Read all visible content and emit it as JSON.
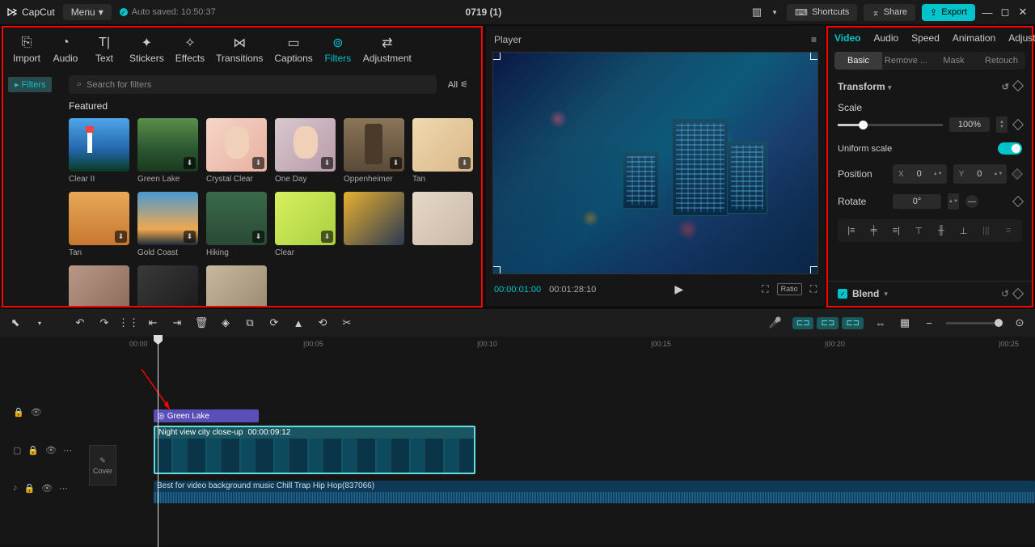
{
  "titlebar": {
    "app_name": "CapCut",
    "menu_label": "Menu",
    "autosave": "Auto saved: 10:50:37",
    "project_title": "0719 (1)",
    "shortcuts": "Shortcuts",
    "share": "Share",
    "export": "Export"
  },
  "tool_tabs": [
    {
      "label": "Import",
      "icon": "⎘"
    },
    {
      "label": "Audio",
      "icon": "◔"
    },
    {
      "label": "Text",
      "icon": "T|"
    },
    {
      "label": "Stickers",
      "icon": "✦"
    },
    {
      "label": "Effects",
      "icon": "✧"
    },
    {
      "label": "Transitions",
      "icon": "⋈"
    },
    {
      "label": "Captions",
      "icon": "▭"
    },
    {
      "label": "Filters",
      "icon": "⊚",
      "active": true
    },
    {
      "label": "Adjustment",
      "icon": "⇄"
    }
  ],
  "filters_sidebar": {
    "tag": "Filters"
  },
  "search": {
    "placeholder": "Search for filters",
    "all_label": "All"
  },
  "featured_label": "Featured",
  "filters": [
    {
      "name": "Clear II",
      "bg": "linear-gradient(180deg,#4fa4e8 0%,#2266aa 60%,#0a3a22 100%)",
      "dl": false,
      "extra": "lighthouse"
    },
    {
      "name": "Green Lake",
      "bg": "linear-gradient(180deg,#5a8f4a 0%,#2a5530 60%,#1a3a20 100%)",
      "dl": true,
      "extra": "cabin"
    },
    {
      "name": "Crystal Clear",
      "bg": "linear-gradient(135deg,#f5d5c8 0%,#e8b0a0 100%)",
      "dl": true,
      "extra": "face"
    },
    {
      "name": "One Day",
      "bg": "linear-gradient(135deg,#d8c8d0 0%,#b89aa8 100%)",
      "dl": true,
      "extra": "face"
    },
    {
      "name": "Oppenheimer",
      "bg": "linear-gradient(180deg,#8a7558 0%,#5a4a38 100%)",
      "dl": true,
      "extra": "man"
    },
    {
      "name": "",
      "bg": "",
      "dl": false
    },
    {
      "name": "Tan",
      "bg": "linear-gradient(135deg,#f0d8b0 0%,#d8b888 100%)",
      "dl": true,
      "extra": "girl"
    },
    {
      "name": "Tan",
      "bg": "linear-gradient(180deg,#e8a858 0%,#c87830 100%)",
      "dl": true,
      "extra": "guy"
    },
    {
      "name": "Gold Coast",
      "bg": "linear-gradient(180deg,#4a9ad0 0%,#f0a850 70%,#1a2a3a 100%)",
      "dl": true,
      "extra": ""
    },
    {
      "name": "Hiking",
      "bg": "linear-gradient(180deg,#3a6a4a 0%,#2a4a35 100%)",
      "dl": true,
      "extra": ""
    },
    {
      "name": "Clear",
      "bg": "linear-gradient(135deg,#d8f060 0%,#a8d040 100%)",
      "dl": true,
      "extra": ""
    },
    {
      "name": "",
      "bg": "",
      "dl": false
    },
    {
      "name": "",
      "bg": "linear-gradient(135deg,#e8b030 0%,#2a3a50 100%)",
      "dl": false
    },
    {
      "name": "",
      "bg": "linear-gradient(135deg,#e8d8c8 0%,#c8b8a8 100%)",
      "dl": false
    },
    {
      "name": "",
      "bg": "linear-gradient(135deg,#b89888 0%,#8a6858 100%)",
      "dl": false
    },
    {
      "name": "",
      "bg": "linear-gradient(135deg,#3a3a3a 0%,#1a1a1a 100%)",
      "dl": false
    },
    {
      "name": "",
      "bg": "linear-gradient(135deg,#c8b8a0 0%,#988870 100%)",
      "dl": false
    }
  ],
  "player": {
    "label": "Player",
    "time_current": "00:00:01:00",
    "time_total": "00:01:28:10",
    "ratio": "Ratio"
  },
  "props": {
    "tabs": [
      "Video",
      "Audio",
      "Speed",
      "Animation",
      "Adjust"
    ],
    "active_tab": "Video",
    "sub_tabs": [
      "Basic",
      "Remove ...",
      "Mask",
      "Retouch"
    ],
    "active_sub": "Basic",
    "transform_label": "Transform",
    "scale_label": "Scale",
    "scale_value": "100%",
    "uniform_label": "Uniform scale",
    "position_label": "Position",
    "pos_x_label": "X",
    "pos_x": "0",
    "pos_y_label": "Y",
    "pos_y": "0",
    "rotate_label": "Rotate",
    "rotate_value": "0°",
    "blend_label": "Blend"
  },
  "timeline": {
    "ticks": [
      "00:00",
      "|00:05",
      "|00:10",
      "|00:15",
      "|00:20",
      "|00:25"
    ],
    "filter_clip": "Green Lake",
    "video_clip_name": "Night view city close-up",
    "video_clip_dur": "00:00:09:12",
    "audio_clip": "Best for video background music Chill Trap Hip Hop(837066)",
    "cover_label": "Cover"
  }
}
